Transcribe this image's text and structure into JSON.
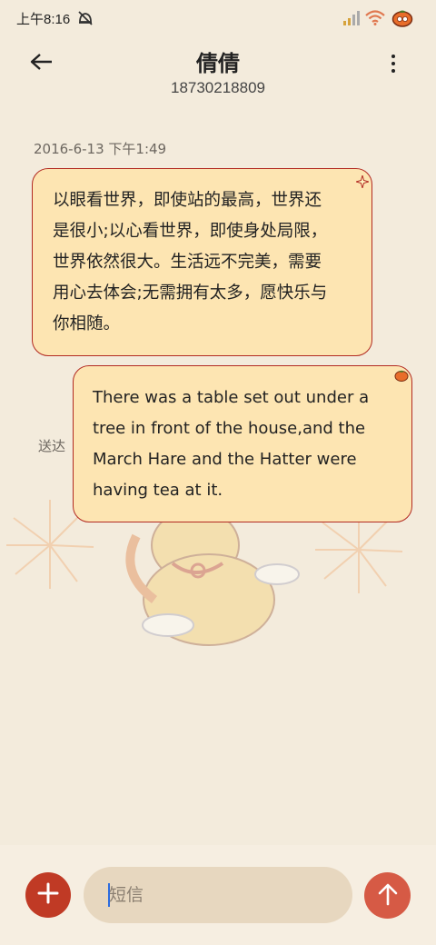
{
  "status_bar": {
    "time": "上午8:16",
    "icons": [
      "mute-alarm-icon",
      "signal-icon",
      "wifi-icon",
      "battery-persimmon-icon"
    ]
  },
  "header": {
    "back_icon": "back-arrow-icon",
    "contact_name": "倩倩",
    "contact_number": "18730218809",
    "more_icon": "more-vertical-icon"
  },
  "conversation": {
    "timestamp": "2016-6-13 下午1:49",
    "messages": [
      {
        "direction": "incoming",
        "lines": [
          "以眼看世界，即使站的最高，世界还",
          "是很小;以心看世界，即使身处局限，",
          "世界依然很大。生活远不完美，需要",
          "用心去体会;无需拥有太多，愿快乐与",
          "你相随。"
        ]
      },
      {
        "direction": "outgoing",
        "lines": [
          "There was a table set out under a",
          "tree in front of the house,and the",
          "March Hare and the Hatter were",
          "having tea at it."
        ]
      }
    ],
    "delivery_status": "送达"
  },
  "composer": {
    "attach_icon": "plus-icon",
    "placeholder": "短信",
    "value": "",
    "send_icon": "send-arrow-icon"
  },
  "colors": {
    "background": "#f3ebdc",
    "bubble_fill": "#fde5b2",
    "bubble_border": "#b22a22",
    "accent_red": "#c03a25",
    "send_button": "#d65a45",
    "input_fill": "#e7d7bf"
  }
}
